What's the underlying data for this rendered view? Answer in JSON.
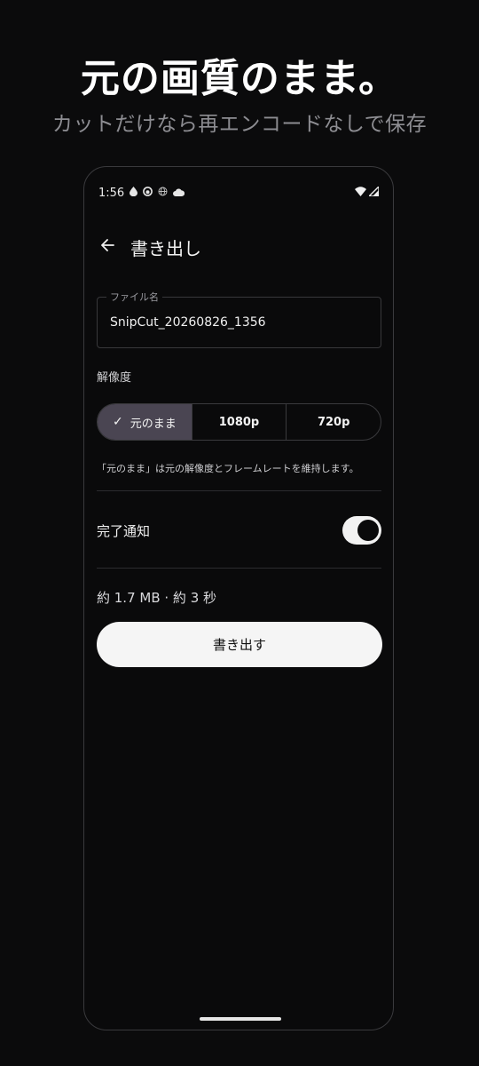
{
  "promo": {
    "headline": "元の画質のまま。",
    "subheadline": "カットだけなら再エンコードなしで保存"
  },
  "status_bar": {
    "time": "1:56",
    "left_icons": [
      "water-drop-icon",
      "face-icon",
      "globe-icon",
      "cloud-icon"
    ],
    "right_icons": [
      "wifi-icon",
      "signal-icon"
    ]
  },
  "app_bar": {
    "back_icon": "arrow-back-icon",
    "title": "書き出し"
  },
  "file_name": {
    "label": "ファイル名",
    "value": "SnipCut_20260826_1356"
  },
  "resolution": {
    "label": "解像度",
    "options": [
      {
        "label": "元のまま",
        "selected": true
      },
      {
        "label": "1080p",
        "selected": false
      },
      {
        "label": "720p",
        "selected": false
      }
    ],
    "hint": "「元のまま」は元の解像度とフレームレートを維持します。"
  },
  "notification": {
    "label": "完了通知",
    "enabled": true
  },
  "estimate": "約 1.7 MB · 約 3 秒",
  "export_button": "書き出す",
  "colors": {
    "background": "#0b0b0c",
    "selected_segment": "#4a4552",
    "primary_button": "#f5f5f5"
  }
}
